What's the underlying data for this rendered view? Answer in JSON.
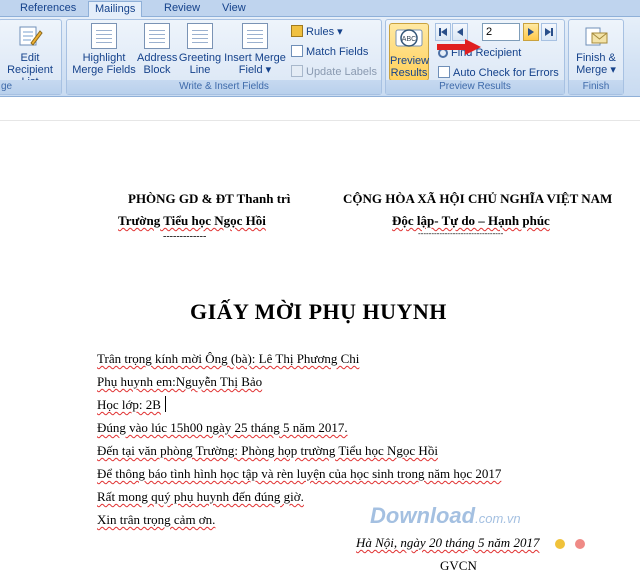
{
  "tabs": [
    {
      "label": "References"
    },
    {
      "label": "Mailings"
    },
    {
      "label": "Review"
    },
    {
      "label": "View"
    }
  ],
  "ribbon": {
    "edit_recipient_l1": "Edit",
    "edit_recipient_l2": "Recipient List",
    "highlight_l1": "Highlight",
    "highlight_l2": "Merge Fields",
    "address_l1": "Address",
    "address_l2": "Block",
    "greeting_l1": "Greeting",
    "greeting_l2": "Line",
    "insert_merge_l1": "Insert Merge",
    "insert_merge_l2": "Field ▾",
    "rules": "Rules ▾",
    "match_fields": "Match Fields",
    "update_labels": "Update Labels",
    "write_insert_label": "Write & Insert Fields",
    "preview_l1": "Preview",
    "preview_l2": "Results",
    "record_number": "2",
    "find_recipient": "Find Recipient",
    "auto_check": "Auto Check for Errors",
    "preview_results_label": "Preview Results",
    "finish_l1": "Finish &",
    "finish_l2": "Merge ▾",
    "finish_label": "Finish",
    "left_group_label": "ge"
  },
  "document": {
    "left_header_1": "PHÒNG GD & ĐT Thanh trì",
    "left_header_2": "Trường Tiểu học Ngọc Hồi",
    "left_dash": "-------------",
    "right_header_1": "CỘNG HÒA XÃ HỘI CHỦ NGHĨA VIỆT NAM",
    "right_header_2": "Độc lập- Tự do – Hạnh phúc",
    "right_dash": "--------------------------------",
    "title": "GIẤY MỜI PHỤ HUYNH",
    "lines": [
      "Trân trọng kính mời Ông (bà): Lê Thị Phương Chi",
      "Phụ huynh em:Nguyễn Thị Bảo",
      "Học lớp: 2B",
      "Đúng vào lúc 15h00 ngày 25 tháng 5 năm 2017.",
      "Đến tại văn phòng Trường: Phòng họp trường Tiểu học Ngọc Hồi",
      "Để thông báo tình hình học tập và rèn luyện của học sinh trong năm học 2017",
      "Rất mong quý phụ huynh đến đúng giờ.",
      "Xin trân trọng cảm ơn."
    ],
    "date_line": "Hà Nội, ngày 20 tháng 5  năm 2017",
    "signature": "GVCN"
  },
  "watermark": {
    "main": "Download",
    "suffix": ".com.vn"
  },
  "colors": {
    "accent_arrow": "#e02020",
    "ribbon_text": "#15428b",
    "active_button": "#ffd05a"
  }
}
